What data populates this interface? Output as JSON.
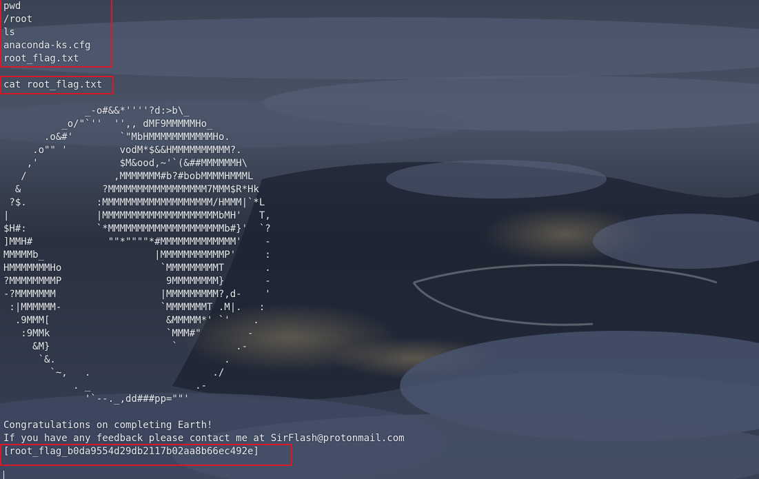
{
  "terminal": {
    "commands_block": [
      "pwd",
      "/root",
      "ls",
      "anaconda-ks.cfg",
      "root_flag.txt"
    ],
    "cat_command": "cat root_flag.txt",
    "ascii_art": [
      "              _-o#&&*''''?d:>b\\_",
      "          _o/\"`''  '',, dMF9MMMMMHo_",
      "       .o&#'        `\"MbHMMMMMMMMMMMHo.",
      "     .o\"\" '         vodM*$&&HMMMMMMMMMM?.",
      "    ,'              $M&ood,~'`(&##MMMMMMH\\",
      "   /               ,MMMMMMM#b?#bobMMMMHMMML",
      "  &              ?MMMMMMMMMMMMMMMMM7MMM$R*Hk",
      " ?$.            :MMMMMMMMMMMMMMMMMMM/HMMM|`*L",
      "|               |MMMMMMMMMMMMMMMMMMMMbMH'   T,",
      "$H#:            `*MMMMMMMMMMMMMMMMMMMMb#}'  `?",
      "]MMH#             \"\"*\"\"\"\"*#MMMMMMMMMMMMM'    -",
      "MMMMMb_                   |MMMMMMMMMMMP'     :",
      "HMMMMMMMHo                 `MMMMMMMMMT       .",
      "?MMMMMMMMP                  9MMMMMMMM}       -",
      "-?MMMMMMM                  |MMMMMMMMM?,d-    '",
      " :|MMMMMM-                 `MMMMMMMT .M|.   :",
      "  .9MMM[                    &MMMMM*' `'    .",
      "   :9MMk                    `MMM#\"        -",
      "     &M}                     `          .-",
      "      `&.                             .",
      "        `~,   .                     ./",
      "            . _                  .-",
      "              '`--._,dd###pp=\"\"'"
    ],
    "congrats_line": "Congratulations on completing Earth!",
    "feedback_line": "If you have any feedback please contact me at SirFlash@protonmail.com",
    "flag_line": "[root_flag_b0da9554d29db2117b02aa8b66ec492e]"
  },
  "colors": {
    "text": "#e8ebf0",
    "highlight_box": "#d8192b",
    "background": "#2b3444"
  }
}
